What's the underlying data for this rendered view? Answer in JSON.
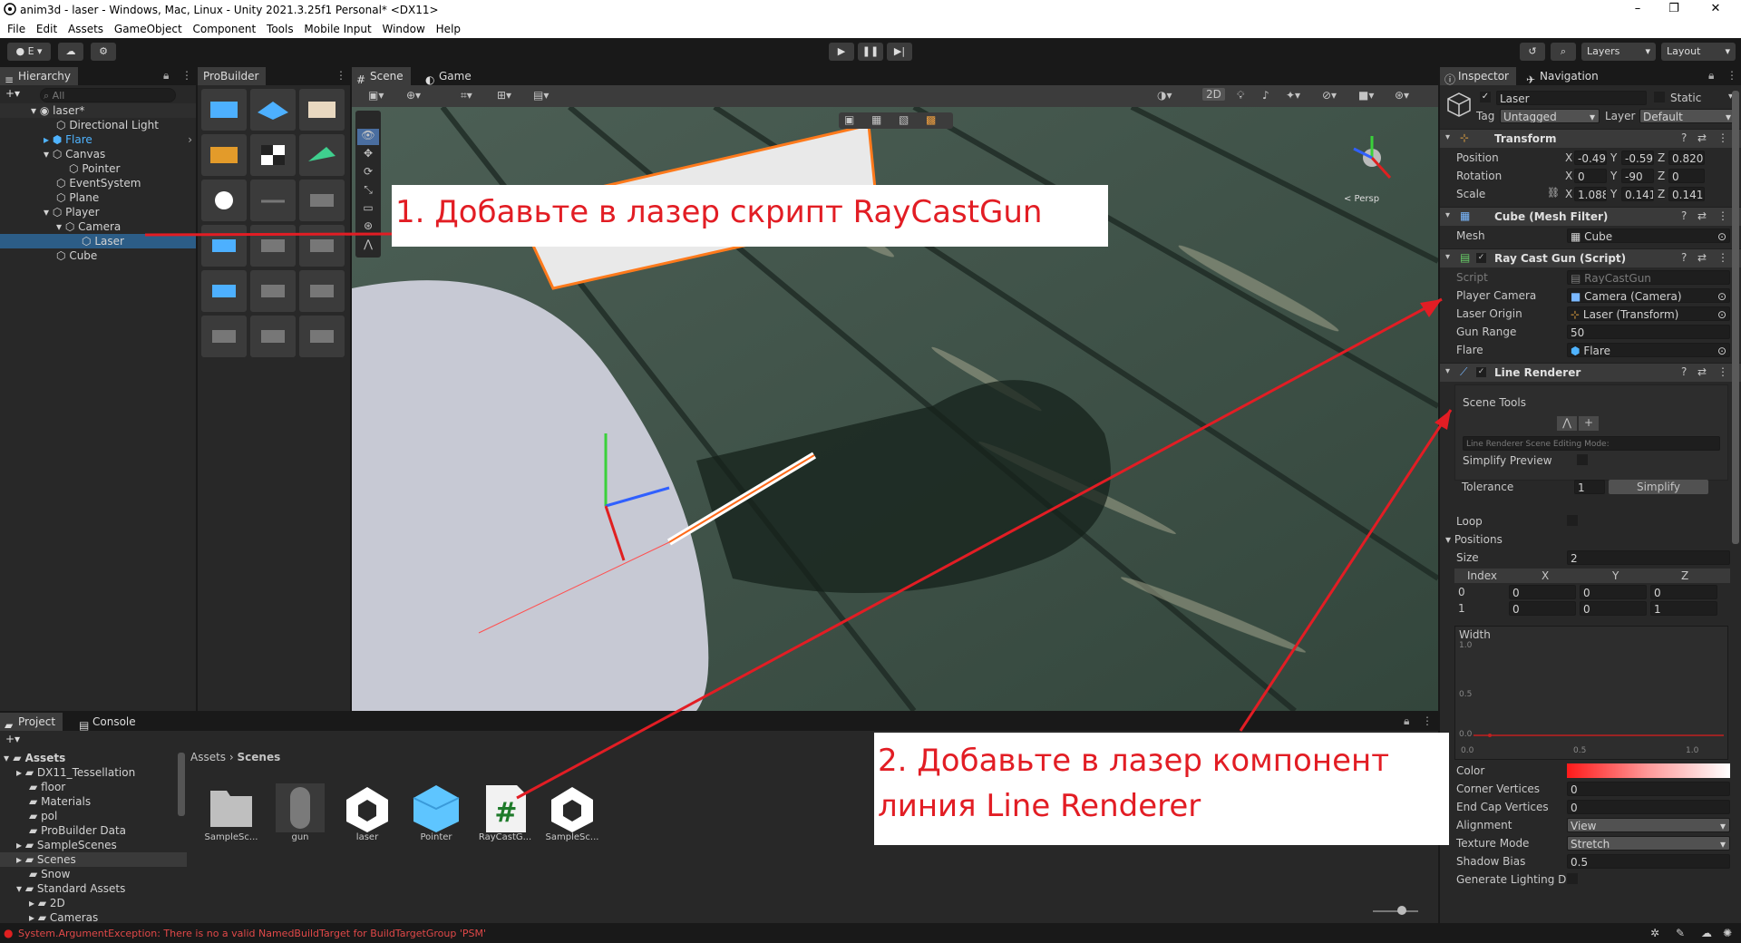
{
  "window": {
    "title": "anim3d - laser - Windows, Mac, Linux - Unity 2021.3.25f1 Personal* <DX11>",
    "minimize": "–",
    "maximize": "❐",
    "close": "✕"
  },
  "menu": [
    "File",
    "Edit",
    "Assets",
    "GameObject",
    "Component",
    "Tools",
    "Mobile Input",
    "Window",
    "Help"
  ],
  "toolbar": {
    "account": "E",
    "layers": "Layers",
    "layout": "Layout"
  },
  "hierarchy": {
    "tab": "Hierarchy",
    "search_placeholder": "All",
    "scene": "laser*",
    "items": [
      "Directional Light",
      "Flare",
      "Canvas",
      "Pointer",
      "EventSystem",
      "Plane",
      "Player",
      "Camera",
      "Laser",
      "Cube"
    ]
  },
  "probuilder": {
    "tab": "ProBuilder"
  },
  "scene_view": {
    "tab_scene": "Scene",
    "tab_game": "Game",
    "btn_2d": "2D",
    "persp": "< Persp"
  },
  "project": {
    "tab_project": "Project",
    "tab_console": "Console",
    "tree": [
      "Assets",
      "DX11_Tessellation",
      "floor",
      "Materials",
      "pol",
      "ProBuilder Data",
      "SampleScenes",
      "Scenes",
      "Snow",
      "Standard Assets",
      "2D",
      "Cameras"
    ],
    "breadcrumb": [
      "Assets",
      "Scenes"
    ],
    "assets": [
      "SampleSc...",
      "gun",
      "laser",
      "Pointer",
      "RayCastG...",
      "SampleSc..."
    ]
  },
  "status": {
    "error": "System.ArgumentException: There is no a valid NamedBuildTarget for BuildTargetGroup 'PSM'"
  },
  "inspector": {
    "tab_inspector": "Inspector",
    "tab_navigation": "Navigation",
    "object_name": "Laser",
    "static": "Static",
    "tag_label": "Tag",
    "tag": "Untagged",
    "layer_label": "Layer",
    "layer": "Default",
    "transform": {
      "title": "Transform",
      "position_label": "Position",
      "rotation_label": "Rotation",
      "scale_label": "Scale",
      "position": [
        "-0.49",
        "-0.59",
        "0.820"
      ],
      "rotation": [
        "0",
        "-90",
        "0"
      ],
      "scale": [
        "1.0882",
        "0.1415",
        "0.1415"
      ]
    },
    "mesh_filter": {
      "title": "Cube (Mesh Filter)",
      "mesh_label": "Mesh",
      "mesh": "Cube"
    },
    "raycast": {
      "title": "Ray Cast Gun (Script)",
      "script_label": "Script",
      "script": "RayCastGun",
      "player_camera_label": "Player Camera",
      "player_camera": "Camera (Camera)",
      "laser_origin_label": "Laser Origin",
      "laser_origin": "Laser (Transform)",
      "gun_range_label": "Gun Range",
      "gun_range": "50",
      "flare_label": "Flare",
      "flare": "Flare"
    },
    "line_renderer": {
      "title": "Line Renderer",
      "scene_tools": "Scene Tools",
      "editing_mode": "Line Renderer Scene Editing Mode:",
      "simplify_preview": "Simplify Preview",
      "tolerance_label": "Tolerance",
      "tolerance": "1",
      "simplify_btn": "Simplify",
      "loop": "Loop",
      "positions": "Positions",
      "size_label": "Size",
      "size": "2",
      "headers": [
        "Index",
        "X",
        "Y",
        "Z"
      ],
      "rows": [
        [
          "0",
          "0",
          "0",
          "0"
        ],
        [
          "1",
          "0",
          "0",
          "1"
        ]
      ],
      "width_label": "Width",
      "width_y_top": "1.0",
      "width_y_mid": "0.5",
      "width_y_bot": "0.0",
      "width_x": [
        "0.0",
        "0.5",
        "1.0"
      ],
      "color_label": "Color",
      "corner_label": "Corner Vertices",
      "corner": "0",
      "endcap_label": "End Cap Vertices",
      "endcap": "0",
      "alignment_label": "Alignment",
      "alignment": "View",
      "texture_label": "Texture Mode",
      "texture": "Stretch",
      "shadow_label": "Shadow Bias",
      "shadow": "0.5",
      "lighting_label": "Generate Lighting Da"
    }
  },
  "annotations": {
    "note1": "1. Добавьте в лазер скрипт RayCastGun",
    "note2_line1": "2. Добавьте в лазер компонент",
    "note2_line2": "линия Line Renderer"
  },
  "colors": {
    "selection": "#2c5d87",
    "annotation": "#e21d24",
    "flare_blue": "#4fb3ff"
  }
}
